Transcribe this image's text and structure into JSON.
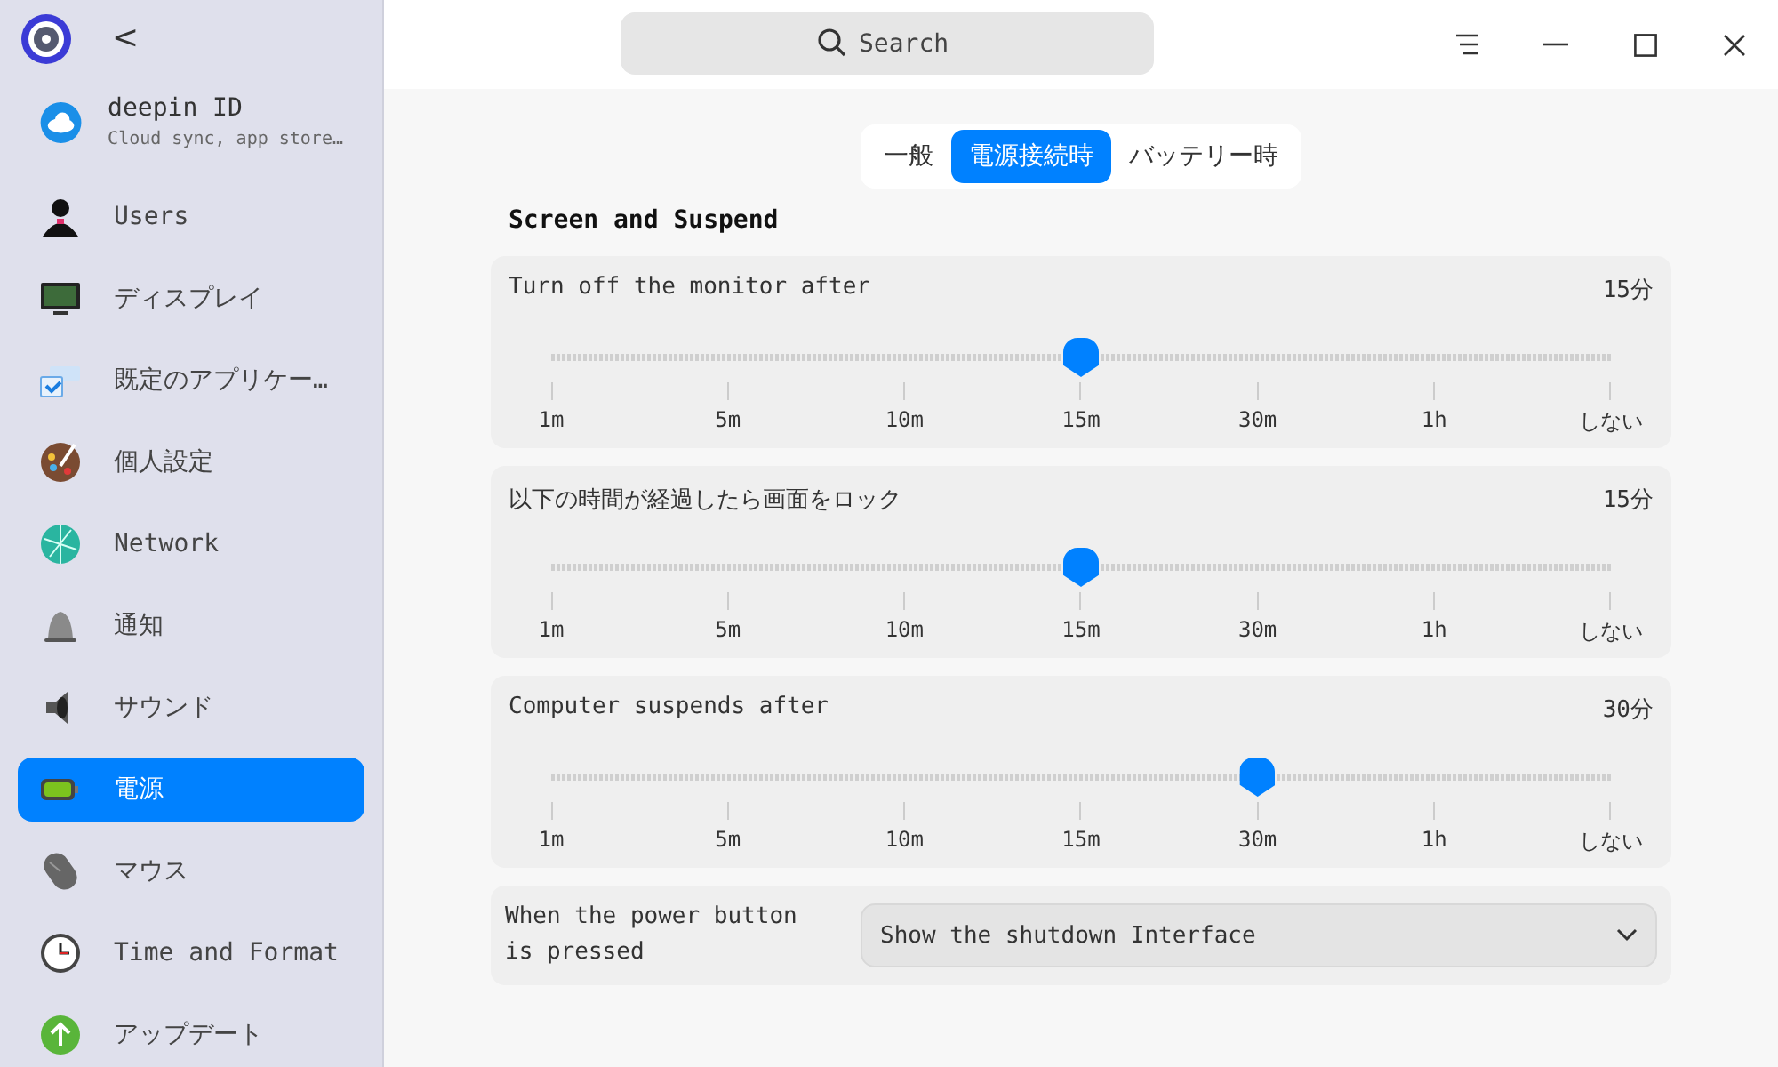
{
  "sidebar": {
    "back": "<",
    "account": {
      "title": "deepin ID",
      "subtitle": "Cloud sync, app store…"
    },
    "items": [
      {
        "label": "Users",
        "selected": false
      },
      {
        "label": "ディスプレイ",
        "selected": false
      },
      {
        "label": "既定のアプリケー…",
        "selected": false
      },
      {
        "label": "個人設定",
        "selected": false
      },
      {
        "label": "Network",
        "selected": false
      },
      {
        "label": "通知",
        "selected": false
      },
      {
        "label": "サウンド",
        "selected": false
      },
      {
        "label": "電源",
        "selected": true
      },
      {
        "label": "マウス",
        "selected": false
      },
      {
        "label": "Time and Format",
        "selected": false
      },
      {
        "label": "アップデート",
        "selected": false
      }
    ]
  },
  "search": {
    "placeholder": "Search"
  },
  "tabs": [
    {
      "label": "一般",
      "selected": false
    },
    {
      "label": "電源接続時",
      "selected": true
    },
    {
      "label": "バッテリー時",
      "selected": false
    }
  ],
  "section_title": "Screen and Suspend",
  "sliders": [
    {
      "label": "Turn off the monitor after",
      "reading": "15分",
      "level": 0.5,
      "ticks": [
        "1m",
        "5m",
        "10m",
        "15m",
        "30m",
        "1h",
        "しない"
      ]
    },
    {
      "label": "以下の時間が経過したら画面をロック",
      "reading": "15分",
      "level": 0.5,
      "ticks": [
        "1m",
        "5m",
        "10m",
        "15m",
        "30m",
        "1h",
        "しない"
      ]
    },
    {
      "label": "Computer suspends after",
      "reading": "30分",
      "level": 0.6667,
      "ticks": [
        "1m",
        "5m",
        "10m",
        "15m",
        "30m",
        "1h",
        "しない"
      ]
    }
  ],
  "power_button": {
    "label": "When the power button is pressed",
    "value": "Show the shutdown Interface"
  }
}
